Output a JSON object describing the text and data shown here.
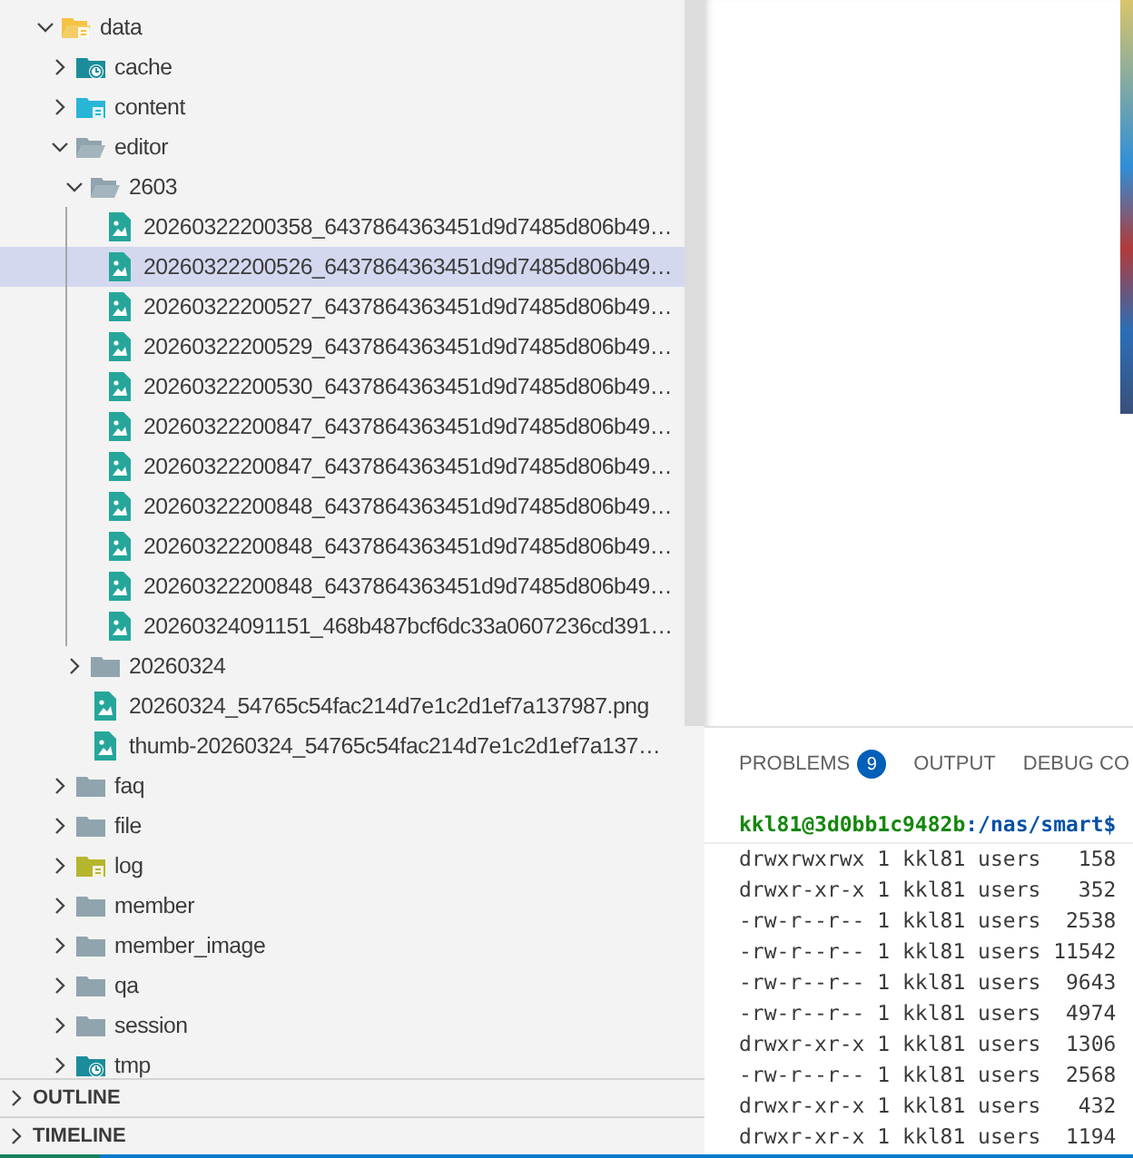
{
  "explorer": {
    "tree": [
      {
        "label": "data",
        "kind": "data",
        "expanded": true,
        "selected": false,
        "children": [
          {
            "label": "cache",
            "kind": "clock",
            "expanded": false,
            "selected": false
          },
          {
            "label": "content",
            "kind": "content",
            "expanded": false,
            "selected": false
          },
          {
            "label": "editor",
            "kind": "folder",
            "expanded": true,
            "selected": false,
            "children": [
              {
                "label": "2603",
                "kind": "folder",
                "expanded": true,
                "selected": false,
                "children": [
                  {
                    "label": "20260322200358_6437864363451d9d7485d806b49…",
                    "kind": "image",
                    "selected": false
                  },
                  {
                    "label": "20260322200526_6437864363451d9d7485d806b49…",
                    "kind": "image",
                    "selected": true
                  },
                  {
                    "label": "20260322200527_6437864363451d9d7485d806b49…",
                    "kind": "image",
                    "selected": false
                  },
                  {
                    "label": "20260322200529_6437864363451d9d7485d806b49…",
                    "kind": "image",
                    "selected": false
                  },
                  {
                    "label": "20260322200530_6437864363451d9d7485d806b49…",
                    "kind": "image",
                    "selected": false
                  },
                  {
                    "label": "20260322200847_6437864363451d9d7485d806b49…",
                    "kind": "image",
                    "selected": false
                  },
                  {
                    "label": "20260322200847_6437864363451d9d7485d806b49…",
                    "kind": "image",
                    "selected": false
                  },
                  {
                    "label": "20260322200848_6437864363451d9d7485d806b49…",
                    "kind": "image",
                    "selected": false
                  },
                  {
                    "label": "20260322200848_6437864363451d9d7485d806b49…",
                    "kind": "image",
                    "selected": false
                  },
                  {
                    "label": "20260322200848_6437864363451d9d7485d806b49…",
                    "kind": "image",
                    "selected": false
                  },
                  {
                    "label": "20260324091151_468b487bcf6dc33a0607236cd391…",
                    "kind": "image",
                    "selected": false
                  }
                ]
              },
              {
                "label": "20260324",
                "kind": "folder",
                "expanded": false,
                "selected": false
              },
              {
                "label": "20260324_54765c54fac214d7e1c2d1ef7a137987.png",
                "kind": "image",
                "selected": false
              },
              {
                "label": "thumb-20260324_54765c54fac214d7e1c2d1ef7a137…",
                "kind": "image",
                "selected": false
              }
            ]
          },
          {
            "label": "faq",
            "kind": "folder",
            "expanded": false,
            "selected": false
          },
          {
            "label": "file",
            "kind": "folder",
            "expanded": false,
            "selected": false
          },
          {
            "label": "log",
            "kind": "log",
            "expanded": false,
            "selected": false
          },
          {
            "label": "member",
            "kind": "folder",
            "expanded": false,
            "selected": false
          },
          {
            "label": "member_image",
            "kind": "folder",
            "expanded": false,
            "selected": false
          },
          {
            "label": "qa",
            "kind": "folder",
            "expanded": false,
            "selected": false
          },
          {
            "label": "session",
            "kind": "folder",
            "expanded": false,
            "selected": false
          },
          {
            "label": "tmp",
            "kind": "clock",
            "expanded": false,
            "selected": false
          }
        ]
      }
    ]
  },
  "sections": [
    {
      "label": "OUTLINE",
      "expanded": false
    },
    {
      "label": "TIMELINE",
      "expanded": false
    }
  ],
  "panel": {
    "tabs": [
      {
        "label": "PROBLEMS",
        "badge": "9",
        "selected": false
      },
      {
        "label": "OUTPUT",
        "selected": false
      },
      {
        "label": "DEBUG CO",
        "selected": false
      }
    ],
    "terminal": {
      "prompt_user_host": "kkl81@3d0bb1c9482b",
      "prompt_path": ":/nas/smart$",
      "lines": [
        "drwxrwxrwx 1 kkl81 users   158",
        "drwxr-xr-x 1 kkl81 users   352",
        "-rw-r--r-- 1 kkl81 users  2538",
        "-rw-r--r-- 1 kkl81 users 11542",
        "-rw-r--r-- 1 kkl81 users  9643",
        "-rw-r--r-- 1 kkl81 users  4974",
        "drwxr-xr-x 1 kkl81 users  1306",
        "-rw-r--r-- 1 kkl81 users  2568",
        "drwxr-xr-x 1 kkl81 users   432",
        "drwxr-xr-x 1 kkl81 users  1194"
      ]
    }
  }
}
